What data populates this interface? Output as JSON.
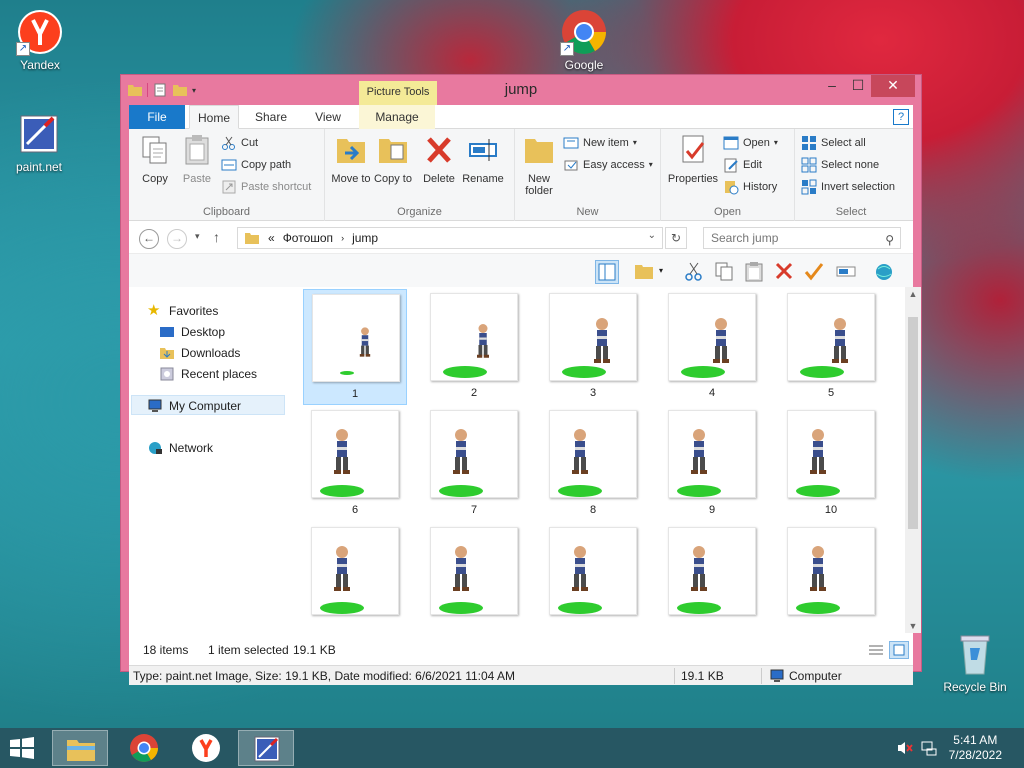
{
  "desktop": {
    "icons": [
      {
        "label": "Yandex"
      },
      {
        "label": "paint.net"
      },
      {
        "label": "Google"
      },
      {
        "label": "Recycle Bin"
      }
    ]
  },
  "window": {
    "title": "jump",
    "contextual_tab_group": "Picture Tools",
    "tabs": [
      "File",
      "Home",
      "Share",
      "View",
      "Manage"
    ],
    "ribbon": {
      "clipboard": {
        "label": "Clipboard",
        "copy": "Copy",
        "paste": "Paste",
        "cut": "Cut",
        "copy_path": "Copy path",
        "paste_shortcut": "Paste shortcut"
      },
      "organize": {
        "label": "Organize",
        "move_to": "Move to",
        "copy_to": "Copy to",
        "delete": "Delete",
        "rename": "Rename"
      },
      "new": {
        "label": "New",
        "new_folder": "New folder",
        "new_item": "New item",
        "easy_access": "Easy access"
      },
      "open": {
        "label": "Open",
        "properties": "Properties",
        "open": "Open",
        "edit": "Edit",
        "history": "History"
      },
      "select": {
        "label": "Select",
        "select_all": "Select all",
        "select_none": "Select none",
        "invert_selection": "Invert selection"
      }
    },
    "address": {
      "prefix": "«",
      "path": [
        "Фотошоп",
        "jump"
      ]
    },
    "search_placeholder": "Search jump",
    "nav": {
      "favorites": "Favorites",
      "desktop": "Desktop",
      "downloads": "Downloads",
      "recent": "Recent places",
      "my_computer": "My Computer",
      "network": "Network"
    },
    "files": [
      "1",
      "2",
      "3",
      "4",
      "5",
      "6",
      "7",
      "8",
      "9",
      "10",
      "",
      "",
      "",
      "",
      ""
    ],
    "status": {
      "items": "18 items",
      "selected": "1 item selected",
      "size": "19.1 KB"
    },
    "details": {
      "text": "Type: paint.net Image, Size: 19.1 KB, Date modified: 6/6/2021 11:04 AM",
      "size": "19.1 KB",
      "location": "Computer"
    }
  },
  "taskbar": {
    "time": "5:41 AM",
    "date": "7/28/2022"
  }
}
